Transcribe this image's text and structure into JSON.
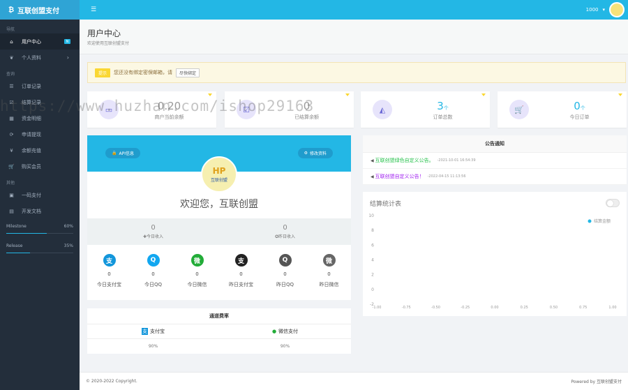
{
  "brand": {
    "title": "互联创盟支付",
    "icon": "bitcoin-icon"
  },
  "topbar": {
    "user": "1000",
    "menu_icon": "list-icon"
  },
  "sidebar": {
    "sections": [
      {
        "title": "导航",
        "items": [
          {
            "label": "用户中心",
            "icon": "home-icon",
            "badge": "N"
          },
          {
            "label": "个人资料",
            "icon": "leaf-icon",
            "arrow": "›"
          }
        ]
      },
      {
        "title": "查询",
        "items": [
          {
            "label": "订单记录",
            "icon": "list-icon"
          },
          {
            "label": "结算记录",
            "icon": "check-icon"
          },
          {
            "label": "资金明细",
            "icon": "table-icon"
          },
          {
            "label": "申请提现",
            "icon": "refresh-icon"
          },
          {
            "label": "余额充值",
            "icon": "yen-icon"
          },
          {
            "label": "购买会员",
            "icon": "cart-icon"
          }
        ]
      },
      {
        "title": "其他",
        "items": [
          {
            "label": "一码支付",
            "icon": "qrcode-icon"
          },
          {
            "label": "开发文档",
            "icon": "book-icon"
          }
        ]
      }
    ],
    "progress": [
      {
        "label": "Milestone",
        "value": "60%",
        "fraction": 0.6
      },
      {
        "label": "Release",
        "value": "35%",
        "fraction": 0.35
      }
    ]
  },
  "header": {
    "title": "用户中心",
    "subtitle": "欢迎使用互联创盟支付"
  },
  "alert": {
    "tag": "提示",
    "text": "您还没有绑定密保邮箱，请",
    "link": "尽快绑定"
  },
  "stats": [
    {
      "value": "0.20",
      "unit": "",
      "caption": "商户当前余额",
      "icon": "money-icon"
    },
    {
      "value": "0",
      "unit": "",
      "caption": "已结算余额",
      "icon": "check-square-icon"
    },
    {
      "value": "3",
      "unit": "个",
      "caption": "订单总数",
      "icon": "area-chart-icon"
    },
    {
      "value": "0",
      "unit": "个",
      "caption": "今日订单",
      "icon": "cart-icon"
    }
  ],
  "profile": {
    "api_button": "API信息",
    "edit_button": "修改资料",
    "logo_text": "互联创盟",
    "welcome": "欢迎您，互联创盟",
    "income": [
      {
        "value": "0",
        "label": "今日收入",
        "prefix": "✚"
      },
      {
        "value": "0",
        "label": "昨日收入",
        "prefix": "✪"
      }
    ],
    "payments": [
      {
        "value": "0",
        "label": "今日支付宝",
        "icon": "alipay-icon",
        "color": "#1296db",
        "glyph": "支"
      },
      {
        "value": "0",
        "label": "今日QQ",
        "icon": "qq-icon",
        "color": "#12a7f0",
        "glyph": "Q"
      },
      {
        "value": "0",
        "label": "今日微信",
        "icon": "wechat-icon",
        "color": "#22ac38",
        "glyph": "微"
      },
      {
        "value": "0",
        "label": "昨日支付宝",
        "icon": "alipay-icon",
        "color": "#222222",
        "glyph": "支"
      },
      {
        "value": "0",
        "label": "昨日QQ",
        "icon": "qq-icon",
        "color": "#555555",
        "glyph": "Q"
      },
      {
        "value": "0",
        "label": "昨日微信",
        "icon": "wechat-icon",
        "color": "#666666",
        "glyph": "微"
      }
    ]
  },
  "channel": {
    "title": "通道费率",
    "items": [
      {
        "name": "支付宝",
        "rate": "90%",
        "icon": "alipay-icon"
      },
      {
        "name": "微信支付",
        "rate": "90%",
        "icon": "wechat-icon"
      }
    ]
  },
  "notices": {
    "title": "公告通知",
    "items": [
      {
        "text": "互联创盟绿色自定义公告。",
        "date": "-2021-10-01 16:54:39",
        "color": "#27c24c"
      },
      {
        "text": "互联创盟自定义公告！",
        "date": "-2022-04-15 11:13:56",
        "color": "#a020f0"
      }
    ]
  },
  "chart_data": {
    "type": "line",
    "title": "结算统计表",
    "series": [
      {
        "name": "结算金额",
        "values": []
      }
    ],
    "xlim": [
      -1.0,
      1.0
    ],
    "ylim": [
      -2,
      10
    ],
    "x_ticks": [
      "-1.00",
      "-0.75",
      "-0.50",
      "-0.25",
      "0.00",
      "0.25",
      "0.50",
      "0.75",
      "1.00"
    ],
    "y_ticks": [
      "10",
      "8",
      "6",
      "4",
      "2",
      "0",
      "-2"
    ],
    "legend": "top-right",
    "color": "#23b7e5"
  },
  "footer": {
    "left": "© 2020-2022 Copyright.",
    "right": "Powered by 互联创盟支付"
  },
  "watermark": "https://www.huzhan.com/ishop29163"
}
